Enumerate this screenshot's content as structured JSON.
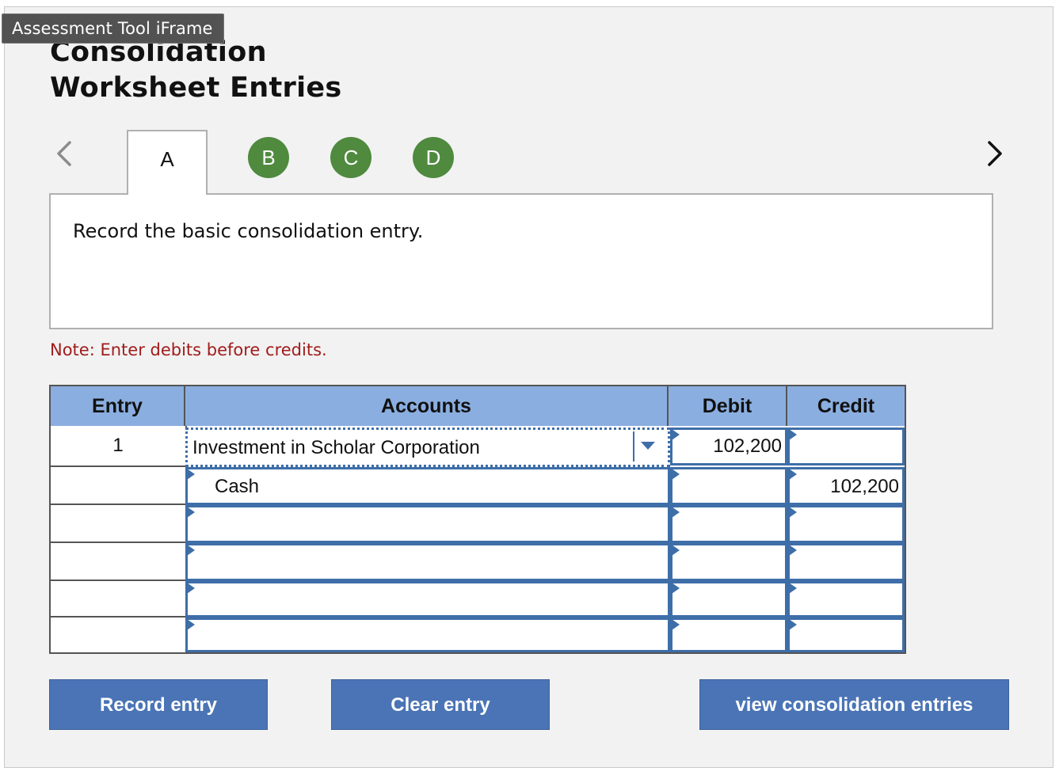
{
  "frame_label": "Assessment Tool iFrame",
  "title_line1": "Consolidation",
  "title_line2": "Worksheet Entries",
  "tabs": [
    {
      "label": "A",
      "active": true
    },
    {
      "label": "B",
      "active": false
    },
    {
      "label": "C",
      "active": false
    },
    {
      "label": "D",
      "active": false
    }
  ],
  "nav": {
    "prev_icon": "chevron-left-icon",
    "next_icon": "chevron-right-icon"
  },
  "instruction": "Record the basic consolidation entry.",
  "note": "Note: Enter debits before credits.",
  "table": {
    "headers": {
      "entry": "Entry",
      "accounts": "Accounts",
      "debit": "Debit",
      "credit": "Credit"
    },
    "rows": [
      {
        "entry": "1",
        "account": "Investment in Scholar Corporation",
        "debit": "102,200",
        "credit": ""
      },
      {
        "entry": "",
        "account": "Cash",
        "debit": "",
        "credit": "102,200"
      },
      {
        "entry": "",
        "account": "",
        "debit": "",
        "credit": ""
      },
      {
        "entry": "",
        "account": "",
        "debit": "",
        "credit": ""
      },
      {
        "entry": "",
        "account": "",
        "debit": "",
        "credit": ""
      },
      {
        "entry": "",
        "account": "",
        "debit": "",
        "credit": ""
      }
    ]
  },
  "buttons": {
    "record": "Record entry",
    "clear": "Clear entry",
    "view": "view consolidation entries"
  },
  "colors": {
    "tab_green": "#4f8a3f",
    "header_blue": "#8aaee0",
    "button_blue": "#4a74b5",
    "note_red": "#a21c1c",
    "input_border": "#3e6ea8"
  }
}
